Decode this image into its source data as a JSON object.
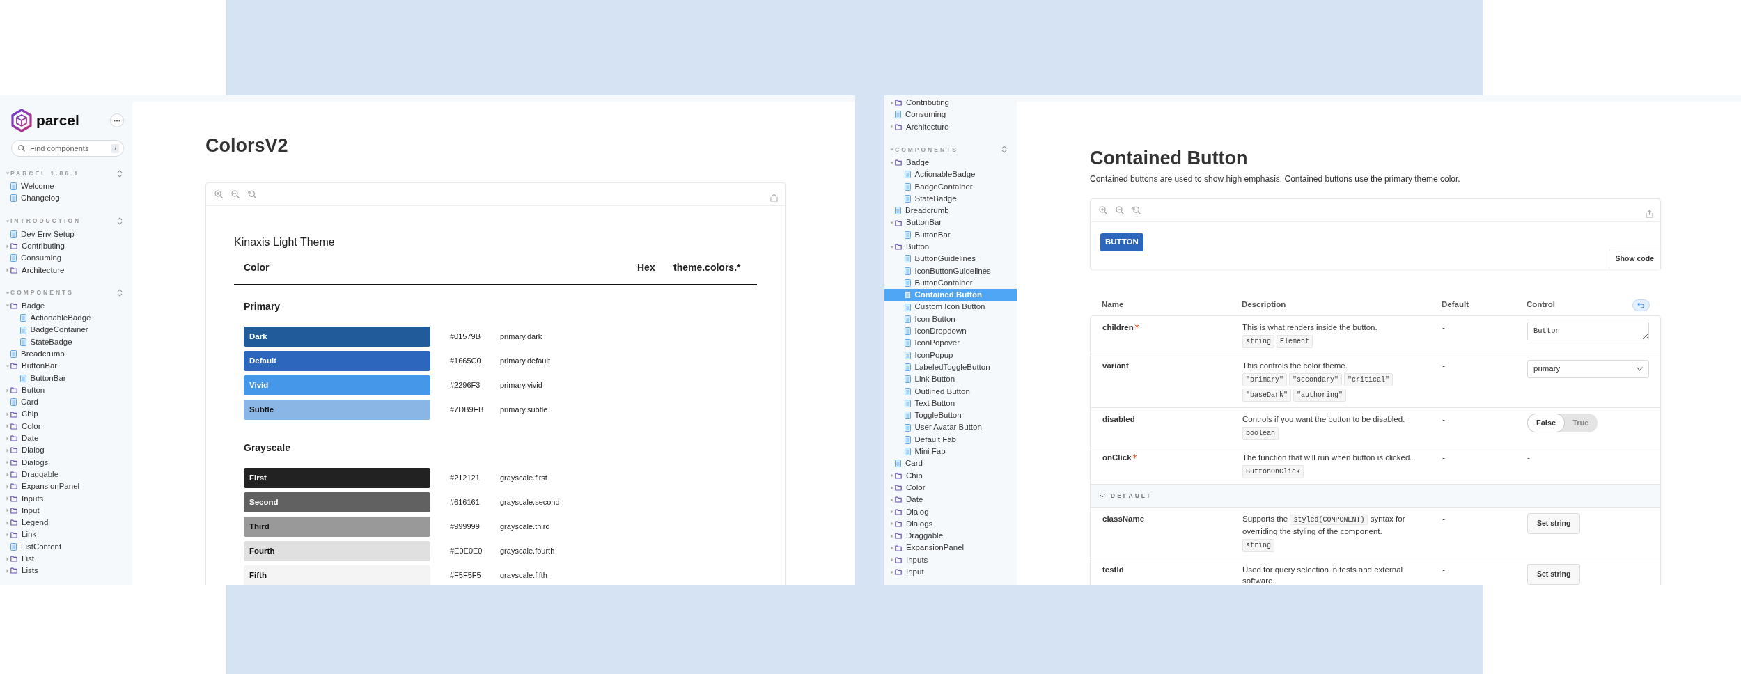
{
  "left_screen": {
    "sidebar": {
      "logo": "parcel",
      "search": {
        "placeholder": "Find components",
        "shortcut": "/"
      },
      "sections": [
        {
          "title": "PARCEL 1.86.1",
          "expanded": true,
          "items": [
            {
              "label": "Welcome",
              "kind": "doc"
            },
            {
              "label": "Changelog",
              "kind": "doc"
            }
          ]
        },
        {
          "title": "INTRODUCTION",
          "expanded": true,
          "items": [
            {
              "label": "Dev Env Setup",
              "kind": "doc"
            },
            {
              "label": "Contributing",
              "kind": "folder",
              "expanded": false
            },
            {
              "label": "Consuming",
              "kind": "doc"
            },
            {
              "label": "Architecture",
              "kind": "folder",
              "expanded": false
            }
          ]
        },
        {
          "title": "COMPONENTS",
          "expanded": true,
          "items": [
            {
              "label": "Badge",
              "kind": "folder",
              "expanded": true,
              "children": [
                {
                  "label": "ActionableBadge",
                  "kind": "doc"
                },
                {
                  "label": "BadgeContainer",
                  "kind": "doc"
                },
                {
                  "label": "StateBadge",
                  "kind": "doc"
                }
              ]
            },
            {
              "label": "Breadcrumb",
              "kind": "doc"
            },
            {
              "label": "ButtonBar",
              "kind": "folder",
              "expanded": true,
              "children": [
                {
                  "label": "ButtonBar",
                  "kind": "doc"
                }
              ]
            },
            {
              "label": "Button",
              "kind": "folder",
              "expanded": false
            },
            {
              "label": "Card",
              "kind": "doc"
            },
            {
              "label": "Chip",
              "kind": "folder",
              "expanded": false
            },
            {
              "label": "Color",
              "kind": "folder",
              "expanded": false
            },
            {
              "label": "Date",
              "kind": "folder",
              "expanded": false
            },
            {
              "label": "Dialog",
              "kind": "folder",
              "expanded": false
            },
            {
              "label": "Dialogs",
              "kind": "folder",
              "expanded": false
            },
            {
              "label": "Draggable",
              "kind": "folder",
              "expanded": false
            },
            {
              "label": "ExpansionPanel",
              "kind": "folder",
              "expanded": false
            },
            {
              "label": "Inputs",
              "kind": "folder",
              "expanded": false
            },
            {
              "label": "Input",
              "kind": "folder",
              "expanded": false
            },
            {
              "label": "Legend",
              "kind": "folder",
              "expanded": false
            },
            {
              "label": "Link",
              "kind": "folder",
              "expanded": false
            },
            {
              "label": "ListContent",
              "kind": "doc"
            },
            {
              "label": "List",
              "kind": "folder",
              "expanded": false
            },
            {
              "label": "Lists",
              "kind": "folder",
              "expanded": false
            }
          ]
        }
      ]
    },
    "page": {
      "title": "ColorsV2",
      "theme_title": "Kinaxis Light Theme",
      "columns": [
        "Color",
        "Hex",
        "theme.colors.*"
      ],
      "groups": [
        {
          "name": "Primary",
          "swatches": [
            {
              "label": "Dark",
              "hex": "#01579B",
              "token": "primary.dark",
              "color": "#215b9a"
            },
            {
              "label": "Default",
              "hex": "#1665C0",
              "token": "primary.default",
              "color": "#2d66bd"
            },
            {
              "label": "Vivid",
              "hex": "#2296F3",
              "token": "primary.vivid",
              "color": "#4597ea"
            },
            {
              "label": "Subtle",
              "hex": "#7DB9EB",
              "token": "primary.subtle",
              "color": "#8ab6e6"
            }
          ]
        },
        {
          "name": "Grayscale",
          "swatches": [
            {
              "label": "First",
              "hex": "#212121",
              "token": "grayscale.first",
              "color": "#222222"
            },
            {
              "label": "Second",
              "hex": "#616161",
              "token": "grayscale.second",
              "color": "#616161"
            },
            {
              "label": "Third",
              "hex": "#999999",
              "token": "grayscale.third",
              "color": "#999999"
            },
            {
              "label": "Fourth",
              "hex": "#E0E0E0",
              "token": "grayscale.fourth",
              "color": "#e0e0e0"
            },
            {
              "label": "Fifth",
              "hex": "#F5F5F5",
              "token": "grayscale.fifth",
              "color": "#f4f4f4"
            }
          ]
        }
      ]
    }
  },
  "right_screen": {
    "sidebar": {
      "sections": [
        {
          "items": [
            {
              "label": "Contributing",
              "kind": "folder",
              "expanded": false,
              "selected": false
            },
            {
              "label": "Consuming",
              "kind": "doc",
              "selected": false
            },
            {
              "label": "Architecture",
              "kind": "folder",
              "expanded": false,
              "selected": false
            }
          ]
        },
        {
          "title": "COMPONENTS",
          "expanded": true,
          "items": [
            {
              "label": "Badge",
              "kind": "folder",
              "expanded": true,
              "selected": false,
              "children": [
                {
                  "label": "ActionableBadge",
                  "kind": "doc",
                  "selected": false
                },
                {
                  "label": "BadgeContainer",
                  "kind": "doc",
                  "selected": false
                },
                {
                  "label": "StateBadge",
                  "kind": "doc",
                  "selected": false
                }
              ]
            },
            {
              "label": "Breadcrumb",
              "kind": "doc",
              "selected": false
            },
            {
              "label": "ButtonBar",
              "kind": "folder",
              "expanded": true,
              "selected": false,
              "children": [
                {
                  "label": "ButtonBar",
                  "kind": "doc",
                  "selected": false
                }
              ]
            },
            {
              "label": "Button",
              "kind": "folder",
              "expanded": true,
              "selected": false,
              "children": [
                {
                  "label": "ButtonGuidelines",
                  "kind": "doc",
                  "selected": false
                },
                {
                  "label": "IconButtonGuidelines",
                  "kind": "doc",
                  "selected": false
                },
                {
                  "label": "ButtonContainer",
                  "kind": "doc",
                  "selected": false
                },
                {
                  "label": "Contained Button",
                  "kind": "doc",
                  "selected": true
                },
                {
                  "label": "Custom Icon Button",
                  "kind": "doc",
                  "selected": false
                },
                {
                  "label": "Icon Button",
                  "kind": "doc",
                  "selected": false
                },
                {
                  "label": "IconDropdown",
                  "kind": "doc",
                  "selected": false
                },
                {
                  "label": "IconPopover",
                  "kind": "doc",
                  "selected": false
                },
                {
                  "label": "IconPopup",
                  "kind": "doc",
                  "selected": false
                },
                {
                  "label": "LabeledToggleButton",
                  "kind": "doc",
                  "selected": false
                },
                {
                  "label": "Link Button",
                  "kind": "doc",
                  "selected": false
                },
                {
                  "label": "Outlined Button",
                  "kind": "doc",
                  "selected": false
                },
                {
                  "label": "Text Button",
                  "kind": "doc",
                  "selected": false
                },
                {
                  "label": "ToggleButton",
                  "kind": "doc",
                  "selected": false
                },
                {
                  "label": "User Avatar Button",
                  "kind": "doc",
                  "selected": false
                },
                {
                  "label": "Default Fab",
                  "kind": "doc",
                  "selected": false
                },
                {
                  "label": "Mini Fab",
                  "kind": "doc",
                  "selected": false
                }
              ]
            },
            {
              "label": "Card",
              "kind": "doc",
              "selected": false
            },
            {
              "label": "Chip",
              "kind": "folder",
              "expanded": false,
              "selected": false
            },
            {
              "label": "Color",
              "kind": "folder",
              "expanded": false,
              "selected": false
            },
            {
              "label": "Date",
              "kind": "folder",
              "expanded": false,
              "selected": false
            },
            {
              "label": "Dialog",
              "kind": "folder",
              "expanded": false,
              "selected": false
            },
            {
              "label": "Dialogs",
              "kind": "folder",
              "expanded": false,
              "selected": false
            },
            {
              "label": "Draggable",
              "kind": "folder",
              "expanded": false,
              "selected": false
            },
            {
              "label": "ExpansionPanel",
              "kind": "folder",
              "expanded": false,
              "selected": false
            },
            {
              "label": "Inputs",
              "kind": "folder",
              "expanded": false,
              "selected": false
            },
            {
              "label": "Input",
              "kind": "folder",
              "expanded": false,
              "selected": false
            }
          ]
        }
      ]
    },
    "page": {
      "title": "Contained Button",
      "description": "Contained buttons are used to show high emphasis. Contained buttons use the primary theme color.",
      "demo_button": "BUTTON",
      "show_code": "Show code",
      "table": {
        "columns": [
          "Name",
          "Description",
          "Default",
          "Control"
        ],
        "rows": [
          {
            "kind": "prop",
            "name": "children",
            "required": true,
            "description": [
              {
                "kind": "text",
                "text": "This is what renders inside the button."
              }
            ],
            "types": [
              "string",
              "Element"
            ],
            "default": "-",
            "control": {
              "kind": "textarea",
              "value": "Button"
            }
          },
          {
            "kind": "prop",
            "name": "variant",
            "required": false,
            "description": [
              {
                "kind": "text",
                "text": "This controls the color theme."
              }
            ],
            "types": [
              "\"primary\"",
              "\"secondary\"",
              "\"critical\"",
              "\"baseDark\"",
              "\"authoring\""
            ],
            "default": "-",
            "control": {
              "kind": "select",
              "value": "primary"
            }
          },
          {
            "kind": "prop",
            "name": "disabled",
            "required": false,
            "description": [
              {
                "kind": "text",
                "text": "Controls if you want the button to be disabled."
              }
            ],
            "types": [
              "boolean"
            ],
            "default": "-",
            "control": {
              "kind": "toggle",
              "options": [
                {
                  "label": "False",
                  "selected": true
                },
                {
                  "label": "True",
                  "selected": false
                }
              ]
            }
          },
          {
            "kind": "prop",
            "name": "onClick",
            "required": true,
            "description": [
              {
                "kind": "text",
                "text": "The function that will run when button is clicked."
              }
            ],
            "types": [
              "ButtonOnClick"
            ],
            "default": "-",
            "control": {
              "kind": "text",
              "value": "-"
            }
          },
          {
            "kind": "section",
            "title": "DEFAULT",
            "expanded": true
          },
          {
            "kind": "prop",
            "name": "className",
            "required": false,
            "description": [
              {
                "kind": "text",
                "text": "Supports the "
              },
              {
                "kind": "code",
                "text": "styled(COMPONENT)"
              },
              {
                "kind": "text",
                "text": " syntax for overriding the styling of the component."
              }
            ],
            "types": [
              "string"
            ],
            "default": "-",
            "control": {
              "kind": "button",
              "label": "Set string"
            }
          },
          {
            "kind": "prop",
            "name": "testId",
            "required": false,
            "description": [
              {
                "kind": "text",
                "text": "Used for query selection in tests and external software."
              }
            ],
            "default": "-",
            "control": {
              "kind": "button",
              "label": "Set string"
            }
          }
        ]
      }
    }
  }
}
